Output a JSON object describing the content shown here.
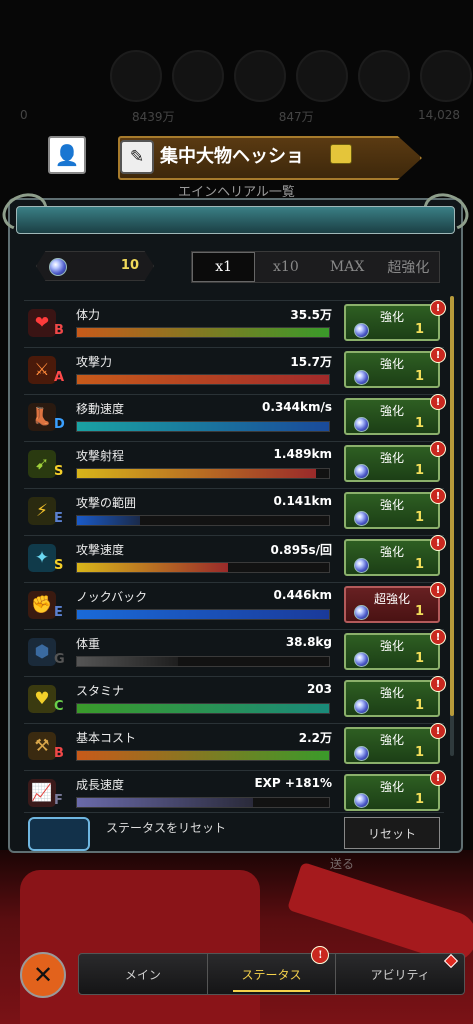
{
  "bg_currency": [
    {
      "value": "0"
    },
    {
      "value": "8439万"
    },
    {
      "value": "847万"
    },
    {
      "value": "14,028"
    }
  ],
  "title": {
    "name": "集中大物ヘッショ",
    "subtitle": "エインヘリアル一覧"
  },
  "gems": {
    "count": "10"
  },
  "multiplier": {
    "options": [
      "x1",
      "x10",
      "MAX",
      "超強化"
    ],
    "selected": "x1"
  },
  "stats": [
    {
      "label": "体力",
      "value": "35.5万",
      "grade": "B",
      "grade_color": "#f04848",
      "icon": "heart-icon",
      "glyph": "❤",
      "icon_bg": "#3a1414",
      "icon_color": "#ff3b3b",
      "fill": 1.0,
      "fill_color": "#c85a1a",
      "fill_color2": "#3a9a2a",
      "btn": "強化",
      "btn_num": "1",
      "red": false
    },
    {
      "label": "攻撃力",
      "value": "15.7万",
      "grade": "A",
      "grade_color": "#ff4a4a",
      "icon": "sword-icon",
      "glyph": "⚔",
      "icon_bg": "#4a1a0a",
      "icon_color": "#ff8a3a",
      "fill": 1.0,
      "fill_color": "#c85a1a",
      "fill_color2": "#a22a2a",
      "btn": "強化",
      "btn_num": "1",
      "red": false
    },
    {
      "label": "移動速度",
      "value": "0.344km/s",
      "grade": "D",
      "grade_color": "#3aa0ff",
      "icon": "boot-icon",
      "glyph": "👢",
      "icon_bg": "#2a1a10",
      "icon_color": "#a06040",
      "fill": 1.0,
      "fill_color": "#1aa2a2",
      "fill_color2": "#1a4a9a",
      "btn": "強化",
      "btn_num": "1",
      "red": false
    },
    {
      "label": "攻撃射程",
      "value": "1.489km",
      "grade": "S",
      "grade_color": "#f4cf2a",
      "icon": "bow-icon",
      "glyph": "➹",
      "icon_bg": "#2a3a10",
      "icon_color": "#9fd03a",
      "fill": 0.95,
      "fill_color": "#d8b51a",
      "fill_color2": "#9a2a2a",
      "btn": "強化",
      "btn_num": "1",
      "red": false
    },
    {
      "label": "攻撃の範囲",
      "value": "0.141km",
      "grade": "E",
      "grade_color": "#5a80d0",
      "icon": "claw-icon",
      "glyph": "⚡",
      "icon_bg": "#2a2a10",
      "icon_color": "#f2c02a",
      "fill": 0.25,
      "fill_color": "#1a5ac8",
      "fill_color2": "#1a2a4a",
      "btn": "強化",
      "btn_num": "1",
      "red": false
    },
    {
      "label": "攻撃速度",
      "value": "0.895s/回",
      "grade": "S",
      "grade_color": "#f4cf2a",
      "icon": "blade-icon",
      "glyph": "✦",
      "icon_bg": "#103a4a",
      "icon_color": "#6ad8f2",
      "fill": 0.6,
      "fill_color": "#d8b51a",
      "fill_color2": "#9a2a2a",
      "btn": "強化",
      "btn_num": "1",
      "red": false
    },
    {
      "label": "ノックバック",
      "value": "0.446km",
      "grade": "E",
      "grade_color": "#5a80d0",
      "icon": "fist-icon",
      "glyph": "✊",
      "icon_bg": "#3a1a10",
      "icon_color": "#c86a4a",
      "fill": 1.0,
      "fill_color": "#1a6ad8",
      "fill_color2": "#1a3a9a",
      "btn": "超強化",
      "btn_num": "1",
      "red": true
    },
    {
      "label": "体重",
      "value": "38.8kg",
      "grade": "G",
      "grade_color": "#555",
      "icon": "weight-icon",
      "glyph": "⬢",
      "icon_bg": "#1a2a3a",
      "icon_color": "#3a6aa0",
      "fill": 0.4,
      "fill_color": "#555",
      "fill_color2": "#1e1e1e",
      "btn": "強化",
      "btn_num": "1",
      "red": false
    },
    {
      "label": "スタミナ",
      "value": "203",
      "grade": "C",
      "grade_color": "#6ad04a",
      "icon": "yellow-heart-icon",
      "glyph": "♥",
      "icon_bg": "#3a3a10",
      "icon_color": "#f2d02a",
      "fill": 1.0,
      "fill_color": "#3a9a2a",
      "fill_color2": "#1a8a7a",
      "btn": "強化",
      "btn_num": "1",
      "red": false
    },
    {
      "label": "基本コスト",
      "value": "2.2万",
      "grade": "B",
      "grade_color": "#f04848",
      "icon": "hammer-icon",
      "glyph": "⚒",
      "icon_bg": "#3a2a10",
      "icon_color": "#d8a64a",
      "fill": 1.0,
      "fill_color": "#c85a1a",
      "fill_color2": "#3a9a2a",
      "btn": "強化",
      "btn_num": "1",
      "red": false
    },
    {
      "label": "成長速度",
      "value": "EXP +181%",
      "grade": "F",
      "grade_color": "#7a7a9a",
      "icon": "growth-chart-icon",
      "glyph": "📈",
      "icon_bg": "#3a1a1a",
      "icon_color": "#ff5a5a",
      "fill": 0.7,
      "fill_color": "#6a6aaa",
      "fill_color2": "#2a2a3a",
      "btn": "強化",
      "btn_num": "1",
      "red": false
    }
  ],
  "alert_mark": "!",
  "reset": {
    "text": "ステータスをリセット",
    "button": "リセット"
  },
  "send_label": "送る",
  "close_icon": "✕",
  "nav": {
    "tabs": [
      {
        "label": "メイン"
      },
      {
        "label": "ステータス"
      },
      {
        "label": "アビリティ"
      }
    ],
    "selected": "ステータス"
  },
  "colors": {
    "accent": "#f4d14b",
    "button_green": "#2e5e22",
    "button_red": "#672022"
  }
}
